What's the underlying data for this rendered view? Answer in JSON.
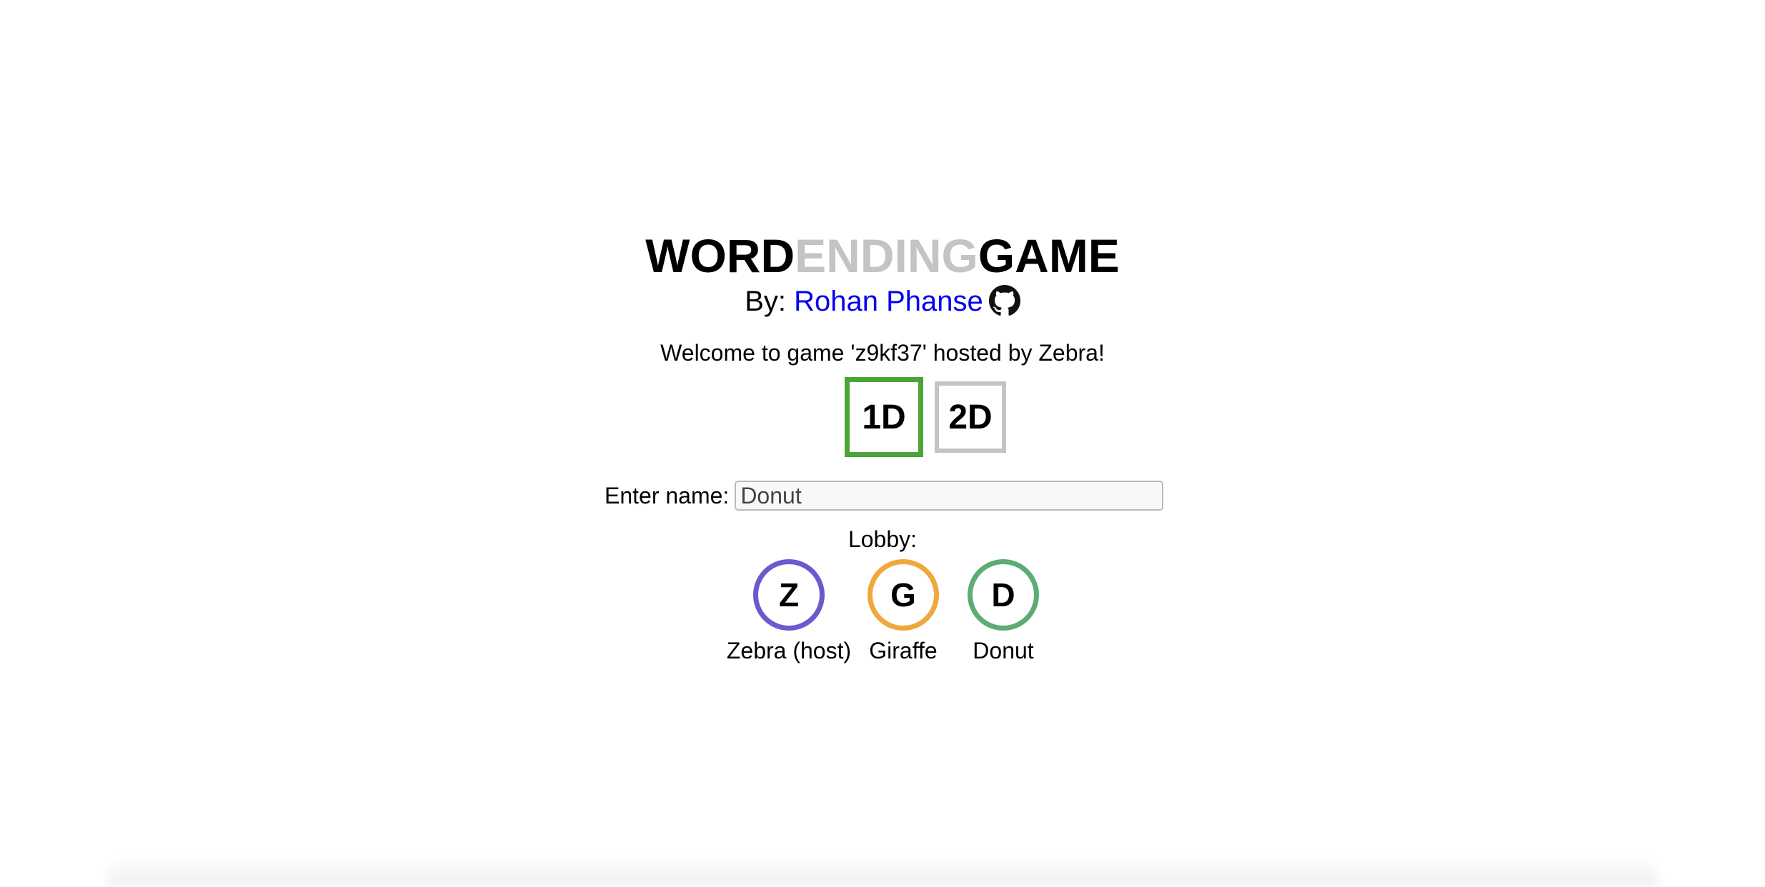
{
  "title": {
    "part1": "WORD",
    "part2": "ENDING",
    "part3": "GAME"
  },
  "byline": {
    "prefix": "By:",
    "author": "Rohan Phanse",
    "icon": "github-icon"
  },
  "welcome_text": "Welcome to game 'z9kf37' hosted by Zebra!",
  "modes": [
    {
      "label": "1D",
      "selected": true,
      "color": "#4aa43a"
    },
    {
      "label": "2D",
      "selected": false,
      "color": "#c4c4c4"
    }
  ],
  "name_field": {
    "label": "Enter name:",
    "value": "Donut"
  },
  "lobby": {
    "label": "Lobby:",
    "players": [
      {
        "initial": "Z",
        "name": "Zebra (host)",
        "color": "#6a5acd"
      },
      {
        "initial": "G",
        "name": "Giraffe",
        "color": "#f0a73c"
      },
      {
        "initial": "D",
        "name": "Donut",
        "color": "#5cac74"
      }
    ]
  }
}
